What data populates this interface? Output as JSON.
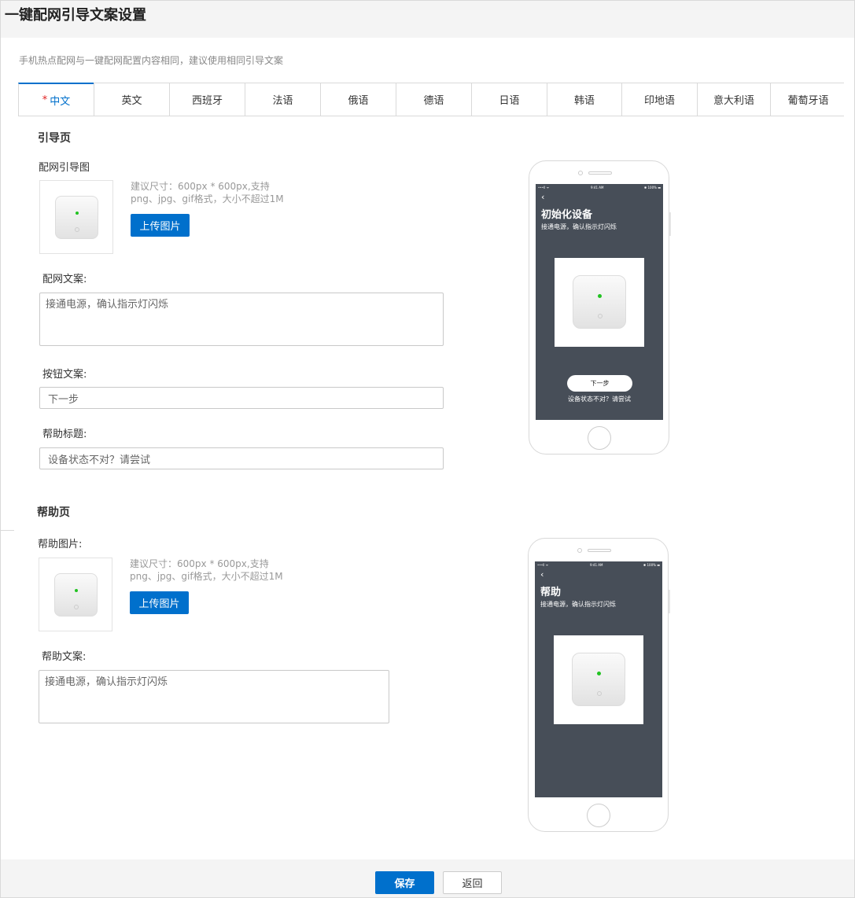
{
  "page": {
    "title": "一键配网引导文案设置",
    "description": "手机热点配网与一键配网配置内容相同，建议使用相同引导文案"
  },
  "tabs": [
    {
      "label": "中文",
      "required": "*",
      "active": true
    },
    {
      "label": "英文"
    },
    {
      "label": "西班牙"
    },
    {
      "label": "法语"
    },
    {
      "label": "俄语"
    },
    {
      "label": "德语"
    },
    {
      "label": "日语"
    },
    {
      "label": "韩语"
    },
    {
      "label": "印地语"
    },
    {
      "label": "意大利语"
    },
    {
      "label": "葡萄牙语"
    }
  ],
  "guide": {
    "section_title": "引导页",
    "image_label": "配网引导图",
    "hint": "建议尺寸：600px * 600px,支持png、jpg、gif格式，大小不超过1M",
    "upload_label": "上传图片",
    "text_label": "配网文案:",
    "text_value": "接通电源，确认指示灯闪烁",
    "button_label": "按钮文案:",
    "button_value": "下一步",
    "help_label": "帮助标题:",
    "help_value": "设备状态不对？请尝试"
  },
  "help": {
    "section_title": "帮助页",
    "image_label": "帮助图片:",
    "hint": "建议尺寸：600px * 600px,支持png、jpg、gif格式，大小不超过1M",
    "upload_label": "上传图片",
    "text_label": "帮助文案:",
    "text_value": "接通电源，确认指示灯闪烁"
  },
  "preview_guide": {
    "status_left": "•••ll ᯤ",
    "status_time": "9:41 AM",
    "status_right": "✱ 100% ▬",
    "back": "‹",
    "title": "初始化设备",
    "subtitle": "接通电源，确认指示灯闪烁",
    "button": "下一步",
    "help": "设备状态不对？请尝试"
  },
  "preview_help": {
    "status_left": "•••ll ᯤ",
    "status_time": "9:41 AM",
    "status_right": "✱ 100% ▬",
    "back": "‹",
    "title": "帮助",
    "subtitle": "接通电源，确认指示灯闪烁"
  },
  "footer": {
    "save": "保存",
    "back": "返回"
  },
  "colors": {
    "primary": "#0070cc",
    "phone_screen": "#474e58",
    "led": "#22c322"
  }
}
